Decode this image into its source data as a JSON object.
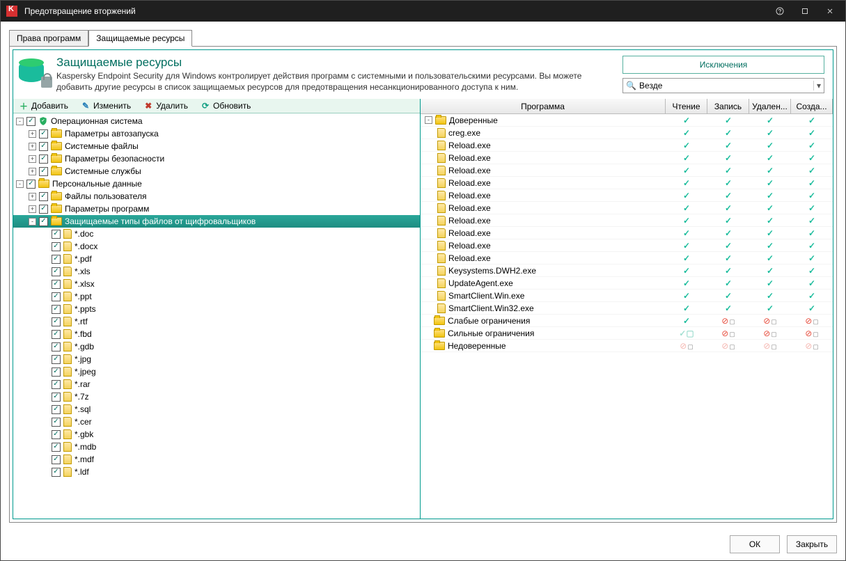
{
  "window": {
    "title": "Предотвращение вторжений"
  },
  "tabs": {
    "rights": "Права программ",
    "resources": "Защищаемые ресурсы"
  },
  "header": {
    "title": "Защищаемые ресурсы",
    "desc": "Kaspersky Endpoint Security для Windows контролирует действия программ с системными и пользовательскими ресурсами. Вы можете добавить другие ресурсы в список защищаемых ресурсов для предотвращения несанкционированного доступа к ним.",
    "exclusions": "Исключения",
    "search_value": "Везде"
  },
  "toolbar": {
    "add": "Добавить",
    "edit": "Изменить",
    "delete": "Удалить",
    "refresh": "Обновить"
  },
  "tree": [
    {
      "indent": 0,
      "exp": "-",
      "chk": true,
      "icon": "shield",
      "label": "Операционная система"
    },
    {
      "indent": 1,
      "exp": "+",
      "chk": true,
      "icon": "fold",
      "label": "Параметры автозапуска"
    },
    {
      "indent": 1,
      "exp": "+",
      "chk": true,
      "icon": "fold",
      "label": "Системные файлы"
    },
    {
      "indent": 1,
      "exp": "+",
      "chk": true,
      "icon": "fold",
      "label": "Параметры безопасности"
    },
    {
      "indent": 1,
      "exp": "+",
      "chk": true,
      "icon": "fold",
      "label": "Системные службы"
    },
    {
      "indent": 0,
      "exp": "-",
      "chk": true,
      "icon": "fold",
      "label": "Персональные данные"
    },
    {
      "indent": 1,
      "exp": "+",
      "chk": true,
      "icon": "fold",
      "label": "Файлы пользователя"
    },
    {
      "indent": 1,
      "exp": "+",
      "chk": true,
      "icon": "fold",
      "label": "Параметры программ"
    },
    {
      "indent": 1,
      "exp": "-",
      "chk": true,
      "icon": "fold",
      "label": "Защищаемые типы файлов от щифровальщиков",
      "sel": true
    },
    {
      "indent": 2,
      "chk": true,
      "icon": "file",
      "label": "*.doc"
    },
    {
      "indent": 2,
      "chk": true,
      "icon": "file",
      "label": "*.docx"
    },
    {
      "indent": 2,
      "chk": true,
      "icon": "file",
      "label": "*.pdf"
    },
    {
      "indent": 2,
      "chk": true,
      "icon": "file",
      "label": "*.xls"
    },
    {
      "indent": 2,
      "chk": true,
      "icon": "file",
      "label": "*.xlsx"
    },
    {
      "indent": 2,
      "chk": true,
      "icon": "file",
      "label": "*.ppt"
    },
    {
      "indent": 2,
      "chk": true,
      "icon": "file",
      "label": "*.ppts"
    },
    {
      "indent": 2,
      "chk": true,
      "icon": "file",
      "label": "*.rtf"
    },
    {
      "indent": 2,
      "chk": true,
      "icon": "file",
      "label": "*.fbd"
    },
    {
      "indent": 2,
      "chk": true,
      "icon": "file",
      "label": "*.gdb"
    },
    {
      "indent": 2,
      "chk": true,
      "icon": "file",
      "label": "*.jpg"
    },
    {
      "indent": 2,
      "chk": true,
      "icon": "file",
      "label": "*.jpeg"
    },
    {
      "indent": 2,
      "chk": true,
      "icon": "file",
      "label": "*.rar"
    },
    {
      "indent": 2,
      "chk": true,
      "icon": "file",
      "label": "*.7z"
    },
    {
      "indent": 2,
      "chk": true,
      "icon": "file",
      "label": "*.sql"
    },
    {
      "indent": 2,
      "chk": true,
      "icon": "file",
      "label": "*.cer"
    },
    {
      "indent": 2,
      "chk": true,
      "icon": "file",
      "label": "*.gbk"
    },
    {
      "indent": 2,
      "chk": true,
      "icon": "file",
      "label": "*.mdb"
    },
    {
      "indent": 2,
      "chk": true,
      "icon": "file",
      "label": "*.mdf"
    },
    {
      "indent": 2,
      "chk": true,
      "icon": "file",
      "label": "*.ldf"
    }
  ],
  "cols": {
    "name": "Программа",
    "read": "Чтение",
    "write": "Запись",
    "del": "Удален...",
    "create": "Созда..."
  },
  "rows": [
    {
      "indent": 0,
      "exp": "-",
      "icon": "fold",
      "label": "Доверенные",
      "perm": "ok"
    },
    {
      "indent": 1,
      "icon": "file",
      "label": "creg.exe",
      "perm": "ok"
    },
    {
      "indent": 1,
      "icon": "file",
      "label": "Reload.exe",
      "perm": "ok"
    },
    {
      "indent": 1,
      "icon": "file",
      "label": "Reload.exe",
      "perm": "ok"
    },
    {
      "indent": 1,
      "icon": "file",
      "label": "Reload.exe",
      "perm": "ok"
    },
    {
      "indent": 1,
      "icon": "file",
      "label": "Reload.exe",
      "perm": "ok"
    },
    {
      "indent": 1,
      "icon": "file",
      "label": "Reload.exe",
      "perm": "ok"
    },
    {
      "indent": 1,
      "icon": "file",
      "label": "Reload.exe",
      "perm": "ok"
    },
    {
      "indent": 1,
      "icon": "file",
      "label": "Reload.exe",
      "perm": "ok"
    },
    {
      "indent": 1,
      "icon": "file",
      "label": "Reload.exe",
      "perm": "ok"
    },
    {
      "indent": 1,
      "icon": "file",
      "label": "Reload.exe",
      "perm": "ok"
    },
    {
      "indent": 1,
      "icon": "file",
      "label": "Reload.exe",
      "perm": "ok"
    },
    {
      "indent": 1,
      "icon": "file",
      "label": "Keysystems.DWH2.exe",
      "perm": "ok"
    },
    {
      "indent": 1,
      "icon": "file",
      "label": "UpdateAgent.exe",
      "perm": "ok"
    },
    {
      "indent": 1,
      "icon": "file",
      "label": "SmartClient.Win.exe",
      "perm": "ok"
    },
    {
      "indent": 1,
      "icon": "file",
      "label": "SmartClient.Win32.exe",
      "perm": "ok"
    },
    {
      "indent": 0,
      "icon": "fold",
      "label": "Слабые ограничения",
      "perm": "low"
    },
    {
      "indent": 0,
      "icon": "fold",
      "label": "Сильные ограничения",
      "perm": "high"
    },
    {
      "indent": 0,
      "icon": "fold",
      "label": "Недоверенные",
      "perm": "none"
    }
  ],
  "footer": {
    "ok": "ОК",
    "close": "Закрыть"
  }
}
